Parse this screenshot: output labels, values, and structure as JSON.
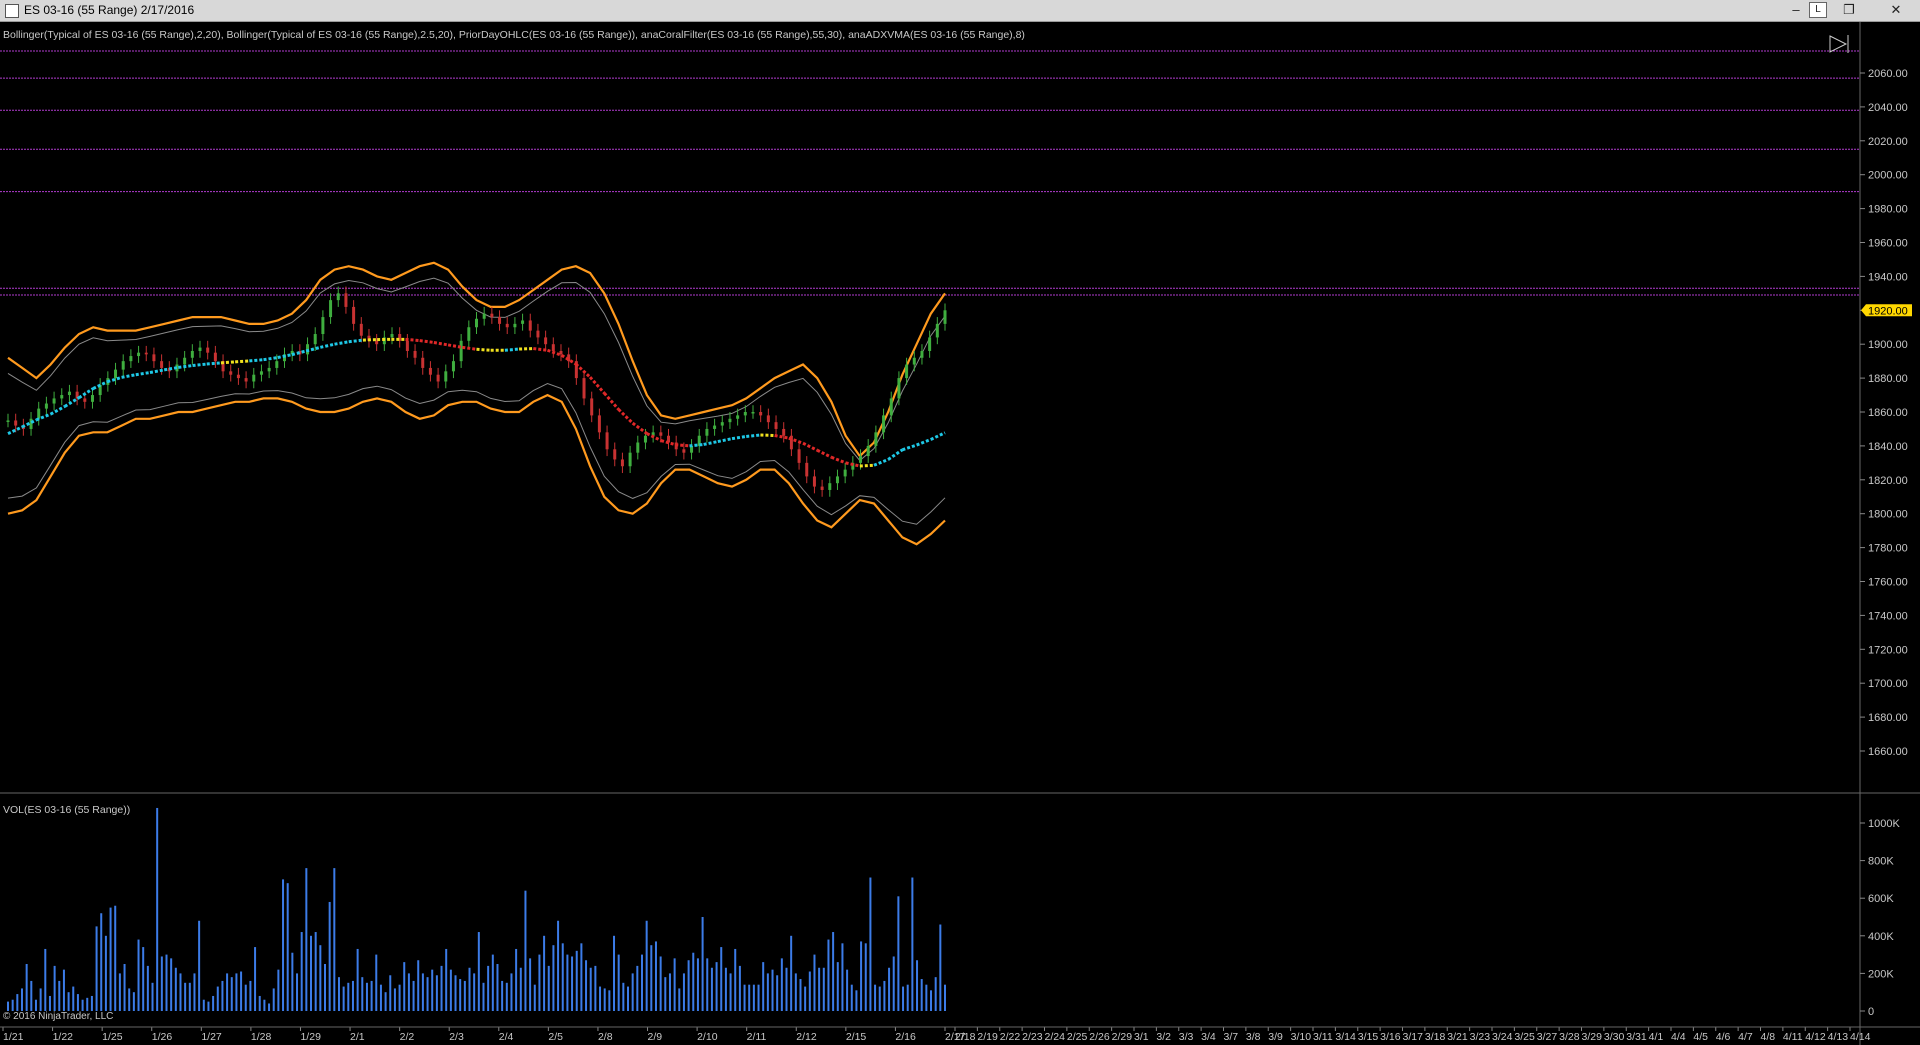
{
  "window": {
    "title": "ES 03-16 (55 Range)  2/17/2016",
    "buttons": {
      "minimize": "‒",
      "link": "L",
      "restore": "❐",
      "close": "✕"
    }
  },
  "indicators_text": "Bollinger(Typical of ES 03-16 (55 Range),2,20), Bollinger(Typical of ES 03-16 (55 Range),2.5,20), PriorDayOHLC(ES 03-16 (55 Range)), anaCoralFilter(ES 03-16 (55 Range),55,30), anaADXVMA(ES 03-16 (55 Range),8)",
  "volume_label": "VOL(ES 03-16 (55 Range))",
  "copyright": "© 2016 NinjaTrader, LLC",
  "colors": {
    "background": "#000000",
    "up_candle": "#3fae3f",
    "down_candle": "#c83232",
    "bollinger_outer": "#ff9a1e",
    "bollinger_inner": "#8a8a8a",
    "prior_day_lines": "#b23cd0",
    "coral_up": "#1ec8e6",
    "coral_flat": "#f0e01e",
    "coral_down": "#e02828",
    "volume": "#3c7ce8",
    "last_price_tag": "#ffd700",
    "axis_text": "#c8c8c8"
  },
  "chart_data": [
    {
      "type": "line",
      "title": "ES 03-16 (55 Range)",
      "ylim": [
        1640,
        2080
      ],
      "y_ticks": [
        1660,
        1680,
        1700,
        1720,
        1740,
        1760,
        1780,
        1800,
        1820,
        1840,
        1860,
        1880,
        1900,
        1920,
        1940,
        1960,
        1980,
        2000,
        2020,
        2040,
        2060
      ],
      "last_price": "1920.00",
      "prior_day_levels": [
        2073,
        2057,
        2038,
        2015,
        1990,
        1933,
        1929
      ],
      "x_labels": [
        "1/21",
        "1/22",
        "1/25",
        "1/26",
        "1/27",
        "1/28",
        "1/29",
        "2/1",
        "2/2",
        "2/3",
        "2/4",
        "2/5",
        "2/8",
        "2/9",
        "2/10",
        "2/11",
        "2/12",
        "2/15",
        "2/16",
        "2/17",
        "2/18",
        "2/19",
        "2/22",
        "2/23",
        "2/24",
        "2/25",
        "2/26",
        "2/29",
        "3/1",
        "3/2",
        "3/3",
        "3/4",
        "3/7",
        "3/8",
        "3/9",
        "3/10",
        "3/11",
        "3/14",
        "3/15",
        "3/16",
        "3/17",
        "3/18",
        "3/21",
        "3/23",
        "3/24",
        "3/25",
        "3/27",
        "3/28",
        "3/29",
        "3/30",
        "3/31",
        "4/1",
        "4/4",
        "4/5",
        "4/6",
        "4/7",
        "4/8",
        "4/11",
        "4/12",
        "4/13",
        "4/14"
      ],
      "price_series": {
        "name": "ES 03-16 (55 Range)",
        "values": [
          1855,
          1852,
          1850,
          1856,
          1862,
          1865,
          1868,
          1870,
          1872,
          1868,
          1866,
          1870,
          1876,
          1880,
          1885,
          1890,
          1893,
          1895,
          1894,
          1890,
          1886,
          1884,
          1888,
          1892,
          1896,
          1898,
          1895,
          1890,
          1884,
          1882,
          1880,
          1878,
          1882,
          1884,
          1886,
          1890,
          1894,
          1896,
          1894,
          1900,
          1906,
          1916,
          1926,
          1930,
          1922,
          1912,
          1905,
          1902,
          1900,
          1904,
          1906,
          1902,
          1896,
          1892,
          1886,
          1882,
          1878,
          1884,
          1890,
          1902,
          1910,
          1915,
          1918,
          1916,
          1912,
          1910,
          1912,
          1914,
          1908,
          1904,
          1900,
          1896,
          1894,
          1890,
          1880,
          1868,
          1858,
          1848,
          1838,
          1832,
          1828,
          1836,
          1842,
          1846,
          1848,
          1846,
          1842,
          1838,
          1836,
          1840,
          1846,
          1850,
          1852,
          1854,
          1856,
          1858,
          1860,
          1860,
          1858,
          1854,
          1850,
          1846,
          1838,
          1830,
          1822,
          1816,
          1814,
          1818,
          1822,
          1826,
          1830,
          1834,
          1840,
          1848,
          1858,
          1868,
          1880,
          1888,
          1892,
          1896,
          1904,
          1912,
          1920
        ]
      },
      "bollinger_upper_2_5": [
        1892,
        1886,
        1880,
        1888,
        1898,
        1906,
        1910,
        1908,
        1908,
        1908,
        1910,
        1912,
        1914,
        1916,
        1916,
        1916,
        1914,
        1912,
        1912,
        1914,
        1918,
        1926,
        1938,
        1944,
        1946,
        1944,
        1940,
        1938,
        1942,
        1946,
        1948,
        1944,
        1934,
        1926,
        1922,
        1922,
        1926,
        1932,
        1938,
        1944,
        1946,
        1942,
        1930,
        1912,
        1890,
        1870,
        1858,
        1856,
        1858,
        1860,
        1862,
        1864,
        1868,
        1874,
        1880,
        1884,
        1888,
        1880,
        1866,
        1846,
        1834,
        1842,
        1860,
        1882,
        1900,
        1918,
        1930
      ],
      "bollinger_lower_2_5": [
        1800,
        1802,
        1808,
        1822,
        1836,
        1846,
        1848,
        1848,
        1852,
        1856,
        1856,
        1858,
        1860,
        1860,
        1862,
        1864,
        1866,
        1866,
        1868,
        1868,
        1866,
        1862,
        1860,
        1860,
        1862,
        1866,
        1868,
        1866,
        1860,
        1856,
        1858,
        1864,
        1866,
        1866,
        1862,
        1860,
        1860,
        1866,
        1870,
        1866,
        1850,
        1828,
        1810,
        1802,
        1800,
        1806,
        1818,
        1826,
        1826,
        1822,
        1818,
        1816,
        1820,
        1826,
        1826,
        1818,
        1806,
        1796,
        1792,
        1800,
        1808,
        1806,
        1796,
        1786,
        1782,
        1788,
        1796
      ]
    },
    {
      "type": "bar",
      "title": "VOL(ES 03-16 (55 Range))",
      "ylim": [
        0,
        1100000
      ],
      "y_ticks": [
        "0",
        "200K",
        "400K",
        "600K",
        "800K",
        "1000K"
      ],
      "values": [
        50000,
        60000,
        90000,
        120000,
        250000,
        160000,
        60000,
        120000,
        330000,
        80000,
        240000,
        160000,
        220000,
        100000,
        130000,
        90000,
        60000,
        70000,
        80000,
        450000,
        520000,
        400000,
        550000,
        560000,
        200000,
        250000,
        120000,
        100000,
        380000,
        340000,
        240000,
        150000,
        1080000,
        290000,
        300000,
        280000,
        230000,
        200000,
        150000,
        150000,
        200000,
        480000,
        60000,
        50000,
        80000,
        130000,
        160000,
        200000,
        180000,
        200000,
        210000,
        140000,
        160000,
        340000,
        80000,
        60000,
        40000,
        120000,
        220000,
        700000,
        680000,
        310000,
        200000,
        420000,
        760000,
        400000,
        420000,
        350000,
        250000,
        580000,
        760000,
        180000,
        130000,
        150000,
        160000,
        330000,
        180000,
        150000,
        160000,
        300000,
        140000,
        100000,
        190000,
        120000,
        140000,
        260000,
        200000,
        160000,
        270000,
        200000,
        180000,
        220000,
        190000,
        240000,
        330000,
        220000,
        190000,
        170000,
        160000,
        230000,
        200000,
        420000,
        150000,
        240000,
        300000,
        250000,
        160000,
        150000,
        200000,
        330000,
        230000,
        640000,
        280000,
        140000,
        300000,
        400000,
        240000,
        350000,
        480000,
        360000,
        300000,
        290000,
        320000,
        360000,
        270000,
        230000,
        240000,
        130000,
        120000,
        110000,
        400000,
        300000,
        150000,
        130000,
        200000,
        240000,
        300000,
        480000,
        350000,
        370000,
        290000,
        180000,
        200000,
        280000,
        120000,
        200000,
        270000,
        310000,
        280000,
        500000,
        280000,
        230000,
        260000,
        340000,
        230000,
        200000,
        330000,
        240000,
        140000,
        140000,
        140000,
        140000,
        260000,
        200000,
        220000,
        190000,
        280000,
        230000,
        400000,
        200000,
        170000,
        130000,
        210000,
        300000,
        230000,
        230000,
        380000,
        420000,
        260000,
        360000,
        220000,
        140000,
        110000,
        370000,
        360000,
        710000,
        140000,
        130000,
        160000,
        230000,
        290000,
        610000,
        130000,
        140000,
        710000,
        270000,
        170000,
        140000,
        110000,
        180000,
        460000,
        140000
      ]
    }
  ]
}
